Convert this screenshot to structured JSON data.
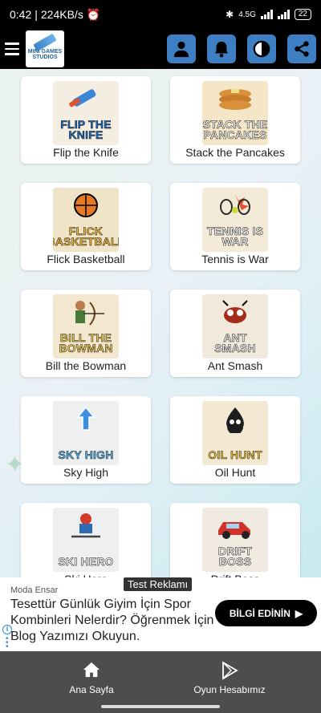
{
  "status_bar": {
    "time": "0:42",
    "network_speed": "224KB/s",
    "signal_label": "4.5G",
    "battery": "22"
  },
  "top_bar": {
    "logo_text": "MINI GAMES STUDIOS"
  },
  "games": [
    {
      "name": "Flip the Knife",
      "thumb_title": "FLIP THE KNIFE",
      "bg": "#f4ede2",
      "title_color": "#1f6fc0"
    },
    {
      "name": "Stack the Pancakes",
      "thumb_title": "STACK THE PANCAKES",
      "bg": "#f6e6c8",
      "title_color": "#fff"
    },
    {
      "name": "Flick Basketball",
      "thumb_title": "FLICK BASKETBALL",
      "bg": "#f0e4c8",
      "title_color": "#f6c23b"
    },
    {
      "name": "Tennis is War",
      "thumb_title": "TENNIS IS WAR",
      "bg": "#f3ead7",
      "title_color": "#fff"
    },
    {
      "name": "Bill the Bowman",
      "thumb_title": "BILL THE BOWMAN",
      "bg": "#f3e8cf",
      "title_color": "#f6d25a"
    },
    {
      "name": "Ant Smash",
      "thumb_title": "ANT SMASH",
      "bg": "#f0e9dc",
      "title_color": "#fff"
    },
    {
      "name": "Sky High",
      "thumb_title": "SKY HIGH",
      "bg": "#eef0ef",
      "title_color": "#5fb4f0"
    },
    {
      "name": "Oil Hunt",
      "thumb_title": "OIL HUNT",
      "bg": "#f3e9d2",
      "title_color": "#f1c542"
    },
    {
      "name": "Ski Hero",
      "thumb_title": "SKI HERO",
      "bg": "#edeff0",
      "title_color": "#fff"
    },
    {
      "name": "Drift Boss",
      "thumb_title": "DRIFT BOSS",
      "bg": "#f0eae0",
      "title_color": "#fff"
    }
  ],
  "ad": {
    "tag": "Test Reklamı",
    "advertiser": "Moda Ensar",
    "text": "Tesettür Günlük Giyim İçin Spor Kombinleri Nelerdir? Öğrenmek İçin Blog Yazımızı Okuyun.",
    "cta": "BİLGİ EDİNİN"
  },
  "bottom_nav": {
    "home_label": "Ana Sayfa",
    "account_label": "Oyun Hesabımız"
  },
  "colors": {
    "accent": "#3e7ec3",
    "bottom_nav_bg": "#4d4d4d"
  }
}
